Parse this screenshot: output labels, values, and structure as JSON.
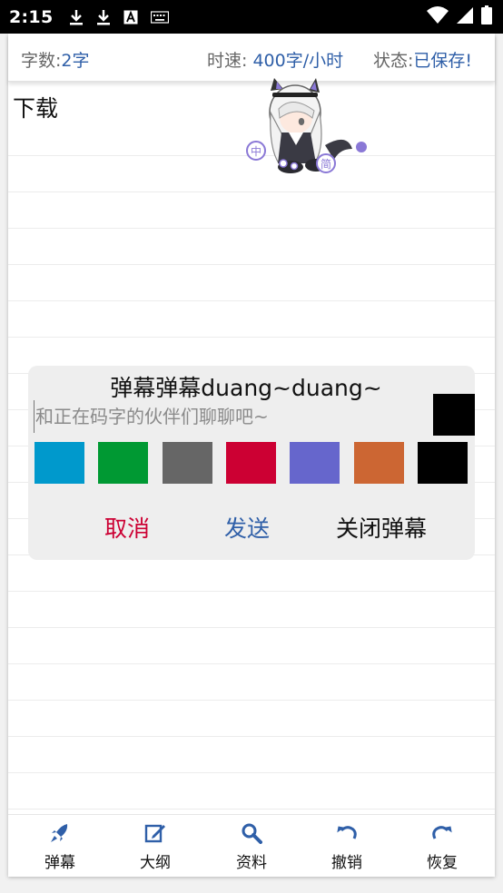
{
  "status_bar": {
    "time": "2:15",
    "icons": [
      "download-icon",
      "download-icon",
      "font-icon",
      "keyboard-icon"
    ],
    "right_icons": [
      "wifi-icon",
      "signal-icon",
      "battery-icon"
    ]
  },
  "info_bar": {
    "word_count_label": "字数:",
    "word_count_value": "2字",
    "speed_label": "时速:",
    "speed_value": "400字/小时",
    "status_label": "状态:",
    "status_value": "已保存!"
  },
  "editor": {
    "text": "下载"
  },
  "mascot": {
    "badge_text_1": "中",
    "badge_text_2": "简"
  },
  "danmaku_dialog": {
    "title": "弹幕弹幕duang~duang~",
    "input_value": "",
    "input_placeholder": "和正在码字的伙伴们聊聊吧~",
    "selected_color": "#000000",
    "colors": [
      "#0099cc",
      "#009933",
      "#666666",
      "#cc0033",
      "#6666cc",
      "#cc6633",
      "#000000"
    ],
    "cancel_label": "取消",
    "send_label": "发送",
    "close_label": "关闭弹幕",
    "cancel_color": "#cc0033",
    "send_color": "#2f5fa8"
  },
  "bottom_nav": [
    {
      "label": "弹幕",
      "icon": "rocket-icon"
    },
    {
      "label": "大纲",
      "icon": "edit-icon"
    },
    {
      "label": "资料",
      "icon": "search-icon"
    },
    {
      "label": "撤销",
      "icon": "undo-icon"
    },
    {
      "label": "恢复",
      "icon": "redo-icon"
    }
  ],
  "accent_color": "#2f5fa8"
}
